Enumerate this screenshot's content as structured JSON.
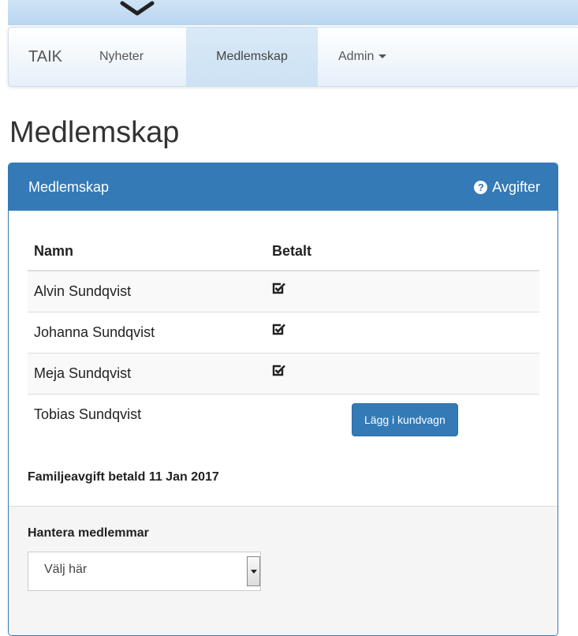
{
  "nav": {
    "brand": "TAIK",
    "items": [
      {
        "label": "Nyheter"
      },
      {
        "label": "Medlemskap",
        "active": true
      },
      {
        "label": "Admin"
      }
    ]
  },
  "page": {
    "title": "Medlemskap"
  },
  "panel": {
    "title": "Medlemskap",
    "fees_link": "Avgifter",
    "table": {
      "headers": [
        "Namn",
        "Betalt"
      ],
      "rows": [
        {
          "name": "Alvin Sundqvist",
          "paid": true
        },
        {
          "name": "Johanna Sundqvist",
          "paid": true
        },
        {
          "name": "Meja Sundqvist",
          "paid": true
        },
        {
          "name": "Tobias Sundqvist",
          "paid": false,
          "action": "Lägg i kundvagn"
        }
      ]
    },
    "family_fee": "Familjeavgift betald 11 Jan 2017"
  },
  "manage": {
    "label": "Hantera medlemmar",
    "select_value": "Välj här"
  },
  "icons": {
    "fees": "question-circle-icon",
    "paid": "checked-checkbox-icon",
    "logo": "chevron-down-icon"
  },
  "colors": {
    "primary": "#337ab7",
    "navbar_active": "#d5e7f6"
  }
}
